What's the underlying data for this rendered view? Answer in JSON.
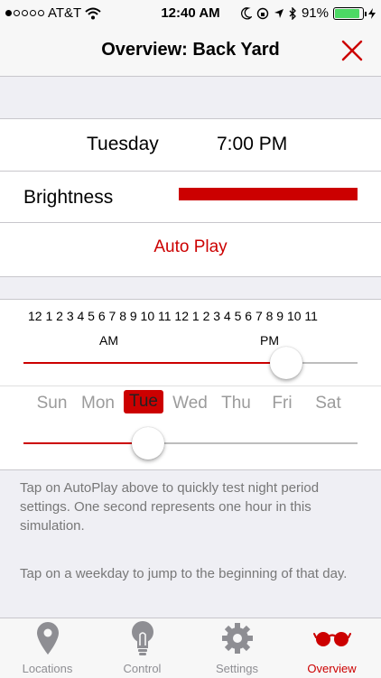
{
  "status": {
    "carrier": "AT&T",
    "time": "12:40 AM",
    "battery": "91%",
    "battery_level": 0.91
  },
  "nav": {
    "title": "Overview: Back Yard"
  },
  "schedule": {
    "day": "Tuesday",
    "time": "7:00 PM"
  },
  "brightness": {
    "label": "Brightness",
    "level": 1.0
  },
  "autoplay": {
    "label": "Auto Play"
  },
  "hours_labels": "12 1 2 3 4 5 6 7 8 9 10 11 12 1 2 3 4 5 6 7 8 9 10 11",
  "am_label": "AM",
  "pm_label": "PM",
  "hour_slider": {
    "value": 19,
    "max": 23
  },
  "days": [
    "Sun",
    "Mon",
    "Tue",
    "Wed",
    "Thu",
    "Fri",
    "Sat"
  ],
  "selected_day": "Tue",
  "day_slider": {
    "value": 2.35,
    "max": 6
  },
  "help": {
    "p1": "Tap on AutoPlay above to quickly test night period settings. One second represents one hour in this simulation.",
    "p2": "Tap on a weekday to jump to the beginning of that day."
  },
  "tabs": [
    {
      "label": "Locations",
      "icon": "map-pin-icon"
    },
    {
      "label": "Control",
      "icon": "lightbulb-icon"
    },
    {
      "label": "Settings",
      "icon": "gear-icon"
    },
    {
      "label": "Overview",
      "icon": "glasses-icon"
    }
  ],
  "colors": {
    "accent": "#cc0000",
    "inactive": "#8e8e93",
    "battery": "#4cd964"
  }
}
